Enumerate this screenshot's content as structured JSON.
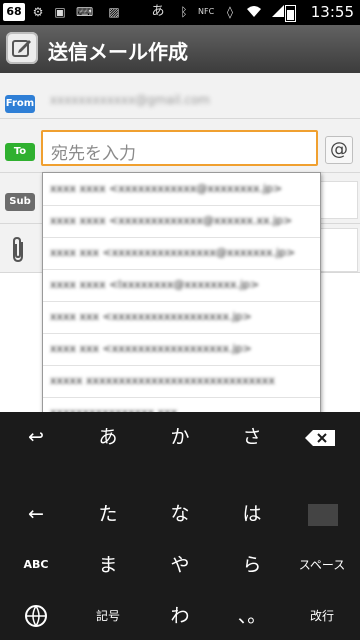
{
  "status_bar": {
    "notification_count": "68",
    "ime_indicator": "あ",
    "time": "13:55",
    "icons": [
      "settings-icon",
      "sd-card-icon",
      "keyboard-icon",
      "image-icon",
      "bluetooth-icon",
      "nfc-icon",
      "vibrate-icon",
      "wifi-icon",
      "signal-icon",
      "battery-icon"
    ]
  },
  "titlebar": {
    "title": "送信メール作成",
    "icon": "compose-icon"
  },
  "form": {
    "from_label": "From",
    "from_value": "xxxxxxxxxxxx@gmail.com",
    "to_label": "To",
    "to_placeholder": "宛先を入力",
    "at_button": "@",
    "subject_label": "Sub",
    "attach_icon": "paperclip-icon"
  },
  "suggestions": [
    "xxxx xxxx <xxxxxxxxxxxx@xxxxxxxx.jp>",
    "xxxx xxxx <xxxxxxxxxxxxx@xxxxxx.xx.jp>",
    "xxxx xxx <xxxxxxxxxxxxxxxx@xxxxxxx.jp>",
    "xxxx xxxx <lxxxxxxxx@xxxxxxxx.jp>",
    "xxxx xxx <xxxxxxxxxxxxxxxxxx.jp>",
    "xxxx xxx <xxxxxxxxxxxxxxxxxx.jp>",
    "xxxxx xxxxxxxxxxxxxxxxxxxxxxxxxxxxx",
    "xxxxxxxxxxxxxxxx.xxx"
  ],
  "keyboard": {
    "row1": [
      "↩",
      "あ",
      "か",
      "さ"
    ],
    "row2": [
      "←",
      "た",
      "な",
      "は"
    ],
    "row3": [
      "ABC",
      "ま",
      "や",
      "ら",
      "スペース"
    ],
    "row4": [
      "記号",
      "わ",
      "、。",
      "改行"
    ],
    "delete_icon": "backspace-icon",
    "globe_icon": "globe-icon"
  }
}
